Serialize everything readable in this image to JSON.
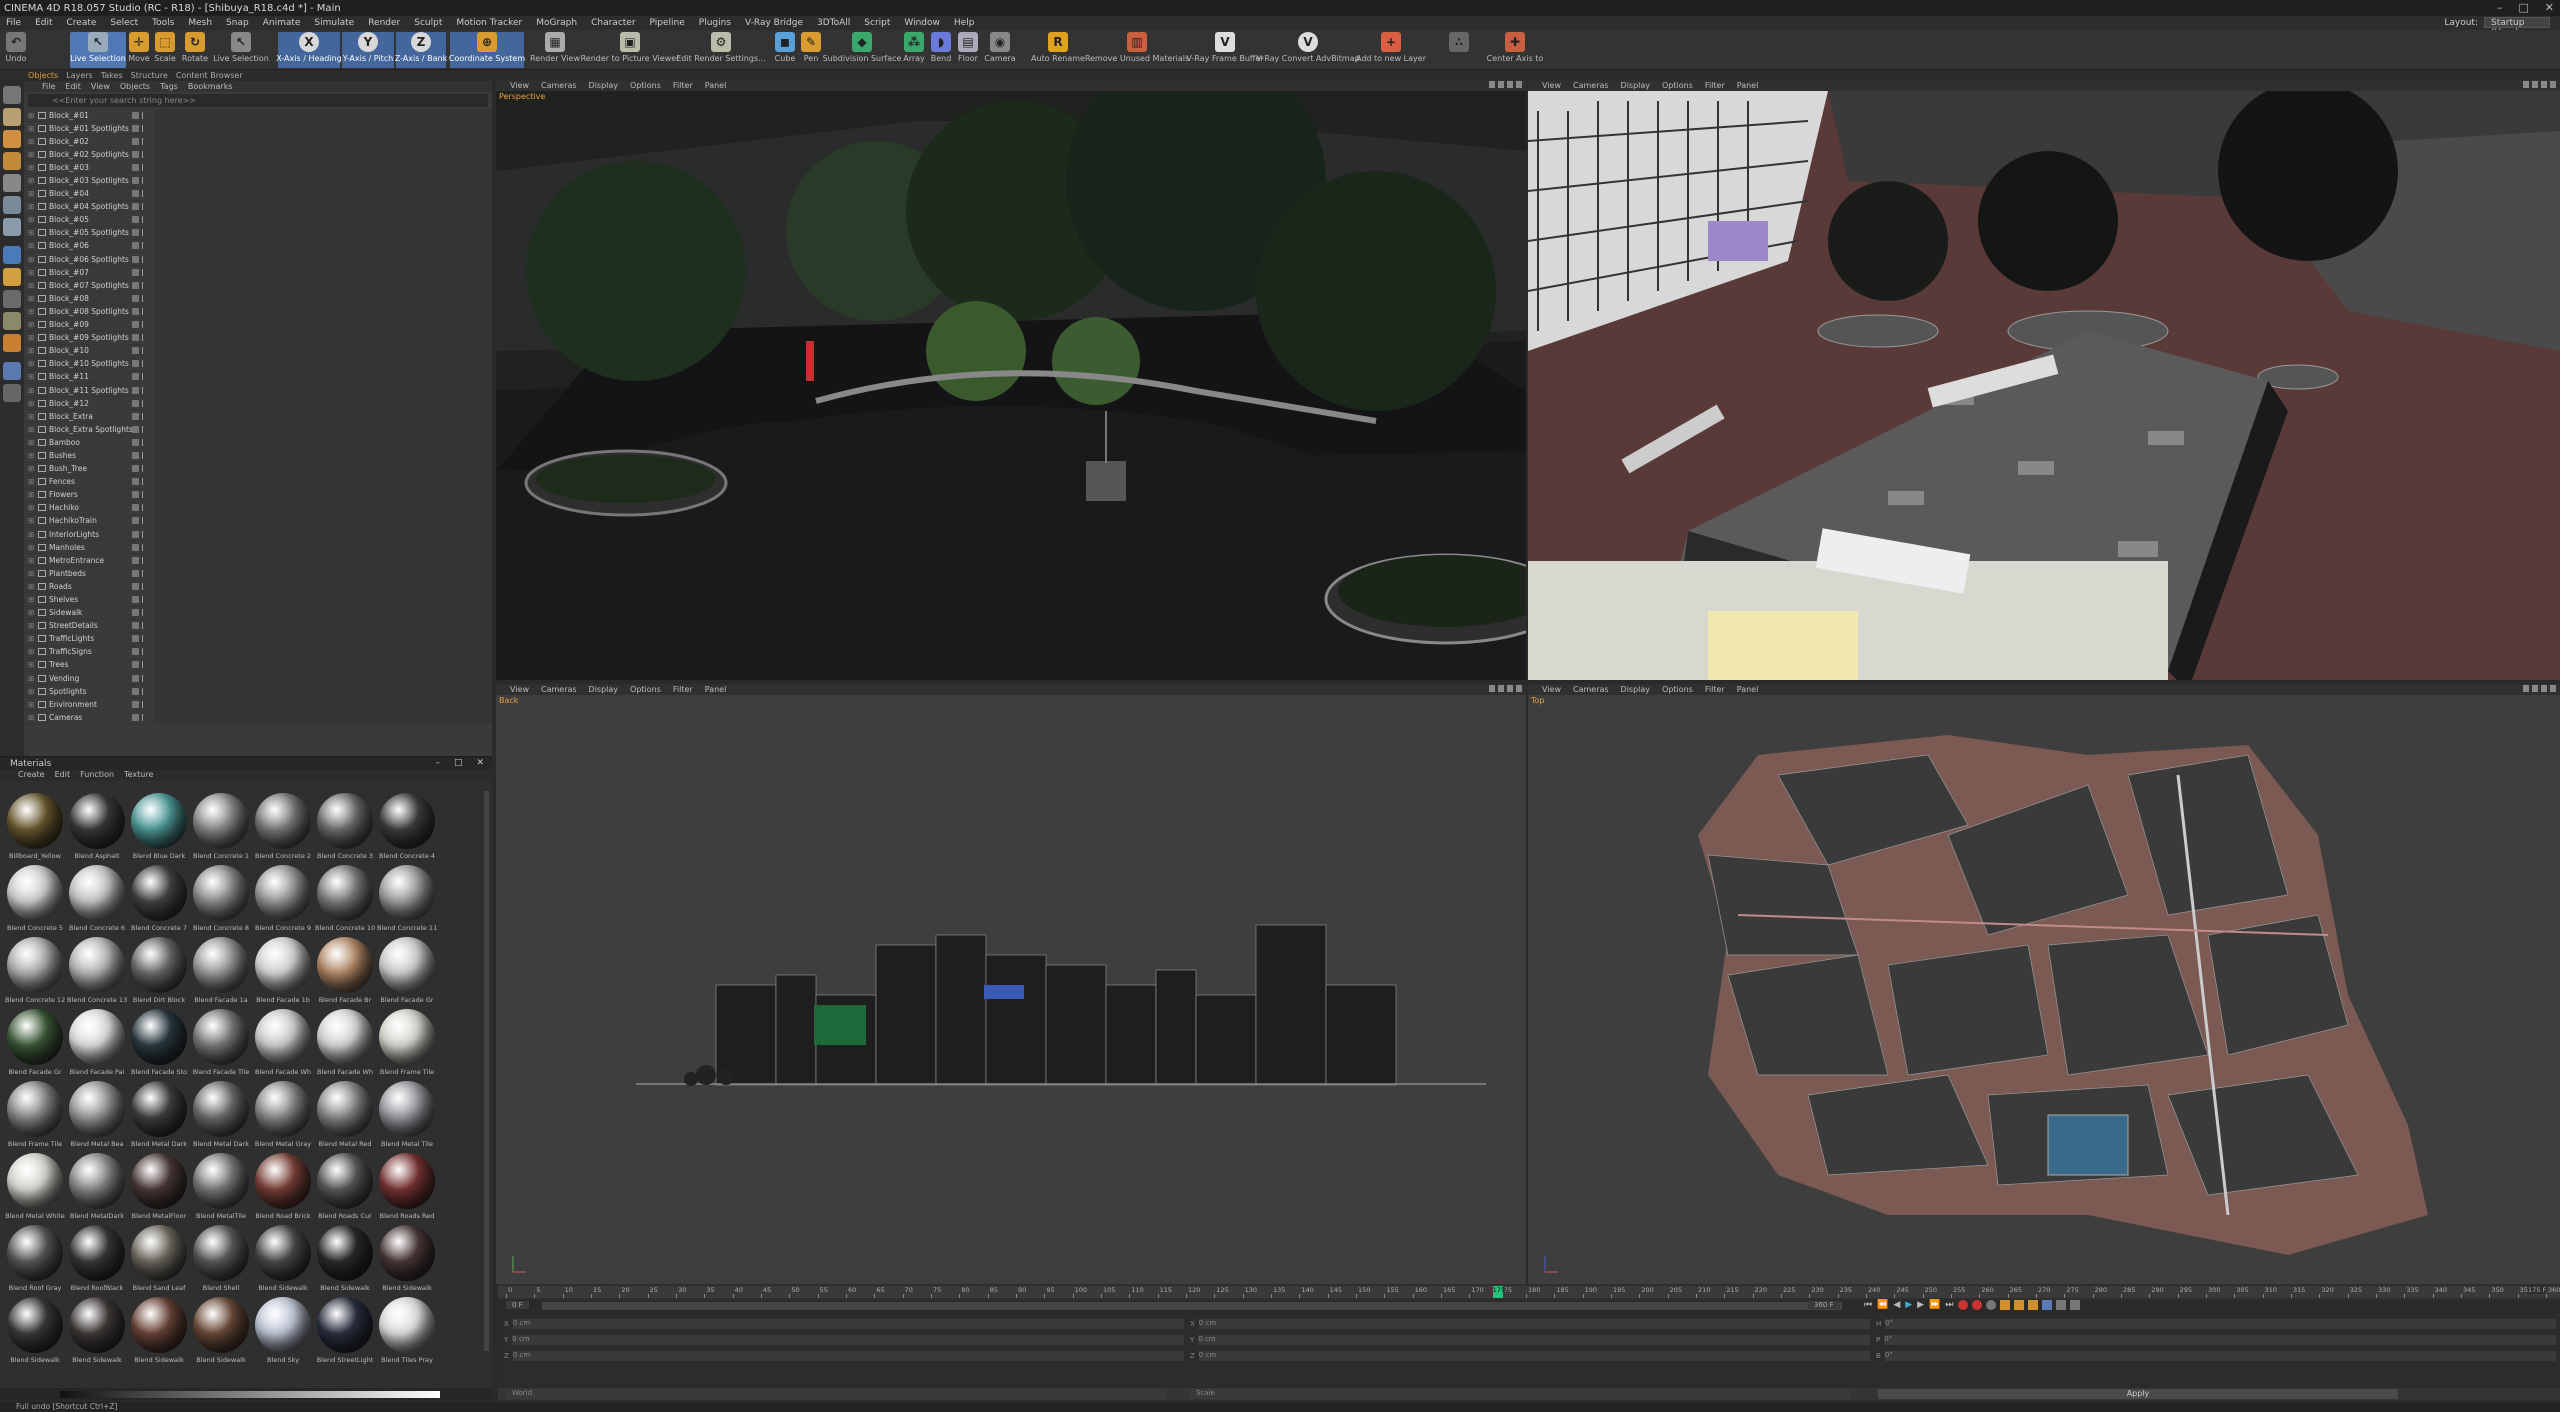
{
  "window": {
    "title": "CINEMA 4D R18.057 Studio (RC - R18) - [Shibuya_R18.c4d *] - Main"
  },
  "menu": {
    "items": [
      "File",
      "Edit",
      "Create",
      "Select",
      "Tools",
      "Mesh",
      "Snap",
      "Animate",
      "Simulate",
      "Render",
      "Sculpt",
      "Motion Tracker",
      "MoGraph",
      "Character",
      "Pipeline",
      "Plugins",
      "V-Ray Bridge",
      "3DToAll",
      "Script",
      "Window",
      "Help"
    ],
    "layout_label": "Layout:",
    "layout_value": "Startup (User)"
  },
  "toolbar": {
    "undo": "Undo",
    "live_selection": "Live Selection",
    "move": "Move",
    "scale": "Scale",
    "rotate": "Rotate",
    "live_selection2": "Live Selection",
    "x_axis": "X-Axis / Heading",
    "y_axis": "Y-Axis / Pitch",
    "z_axis": "Z-Axis / Bank",
    "coord_system": "Coordinate System",
    "render_view": "Render View",
    "render_to_pv": "Render to Picture Viewer",
    "edit_render": "Edit Render Settings...",
    "cube": "Cube",
    "pen": "Pen",
    "subdiv": "Subdivision Surface",
    "array": "Array",
    "bend": "Bend",
    "floor": "Floor",
    "camera": "Camera",
    "auto_rename": "Auto Rename",
    "remove_unused": "Remove Unused Materials",
    "vray_frame_buffer": "V-Ray Frame Buffer",
    "vray_convert": "V-Ray Convert AdvBitmap",
    "add_layer": "Add to new Layer",
    "center_axis": "Center Axis to"
  },
  "object_manager": {
    "tabs": [
      "Objects",
      "Layers",
      "Takes",
      "Structure",
      "Content Browser"
    ],
    "menu": [
      "File",
      "Edit",
      "View",
      "Objects",
      "Tags",
      "Bookmarks"
    ],
    "search_placeholder": "<<Enter your search string here>>",
    "objects": [
      "Block_#01",
      "Block_#01 Spotlights",
      "Block_#02",
      "Block_#02 Spotlights",
      "Block_#03",
      "Block_#03 Spotlights",
      "Block_#04",
      "Block_#04 Spotlights",
      "Block_#05",
      "Block_#05 Spotlights",
      "Block_#06",
      "Block_#06 Spotlights",
      "Block_#07",
      "Block_#07 Spotlights",
      "Block_#08",
      "Block_#08 Spotlights",
      "Block_#09",
      "Block_#09 Spotlights",
      "Block_#10",
      "Block_#10 Spotlights",
      "Block_#11",
      "Block_#11 Spotlights",
      "Block_#12",
      "Block_Extra",
      "Block_Extra Spotlights",
      "Bamboo",
      "Bushes",
      "Bush_Tree",
      "Fences",
      "Flowers",
      "Hachiko",
      "HachikoTrain",
      "InteriorLights",
      "Manholes",
      "MetroEntrance",
      "Plantbeds",
      "Roads",
      "Shelves",
      "Sidewalk",
      "StreetDetails",
      "TrafficLights",
      "TrafficSigns",
      "Trees",
      "Vending",
      "Spotlights",
      "Environment",
      "Cameras"
    ]
  },
  "material_manager": {
    "title": "Materials",
    "menu": [
      "Create",
      "Edit",
      "Function",
      "Texture"
    ],
    "materials": [
      {
        "name": "Billboard_Yellow",
        "color": "#6a5a30"
      },
      {
        "name": "Blend Asphalt",
        "color": "#3a3a3a"
      },
      {
        "name": "Blend Blue Dark",
        "color": "#4d9a98"
      },
      {
        "name": "Blend Concrete 1",
        "color": "#8a8a8a"
      },
      {
        "name": "Blend Concrete 2",
        "color": "#7a7a7a"
      },
      {
        "name": "Blend Concrete 3",
        "color": "#6e6e6e"
      },
      {
        "name": "Blend Concrete 4",
        "color": "#3e3e3e"
      },
      {
        "name": "Blend Concrete 5",
        "color": "#d0d0d0"
      },
      {
        "name": "Blend Concrete 6",
        "color": "#c8c8c8"
      },
      {
        "name": "Blend Concrete 7",
        "color": "#444444"
      },
      {
        "name": "Blend Concrete 8",
        "color": "#8e8e8e"
      },
      {
        "name": "Blend Concrete 9",
        "color": "#9a9a9a"
      },
      {
        "name": "Blend Concrete 10",
        "color": "#7e7e7e"
      },
      {
        "name": "Blend Concrete 11",
        "color": "#a0a0a0"
      },
      {
        "name": "Blend Concrete 12",
        "color": "#b0b0b0"
      },
      {
        "name": "Blend Concrete 13",
        "color": "#b8b8b8"
      },
      {
        "name": "Blend Dirt Block",
        "color": "#6a6a6a"
      },
      {
        "name": "Blend Facade 1a",
        "color": "#9a9a9a"
      },
      {
        "name": "Blend Facade 1b",
        "color": "#d4d4d4"
      },
      {
        "name": "Blend Facade Br",
        "color": "#b48a68"
      },
      {
        "name": "Blend Facade Gr",
        "color": "#cfcfcf"
      },
      {
        "name": "Blend Facade Gr",
        "color": "#3c5a38"
      },
      {
        "name": "Blend Facade Pai",
        "color": "#e0e0e0"
      },
      {
        "name": "Blend Facade Sto",
        "color": "#2a3a40"
      },
      {
        "name": "Blend Facade Tile",
        "color": "#7a7a7a"
      },
      {
        "name": "Blend Facade Wh",
        "color": "#cfcfcf"
      },
      {
        "name": "Blend Facade Wh",
        "color": "#d8d8d8"
      },
      {
        "name": "Blend Frame Tile",
        "color": "#d8d8d0"
      },
      {
        "name": "Blend Frame Tile",
        "color": "#8a8a8a"
      },
      {
        "name": "Blend Metal Bea",
        "color": "#9a9a9a"
      },
      {
        "name": "Blend Metal Dark",
        "color": "#404040"
      },
      {
        "name": "Blend Metal Dark",
        "color": "#6e6e6e"
      },
      {
        "name": "Blend Metal Gray",
        "color": "#8a8a8a"
      },
      {
        "name": "Blend Metal Red",
        "color": "#8a8a8a"
      },
      {
        "name": "Blend Metal Tile",
        "color": "#9a9aa0"
      },
      {
        "name": "Blend Metal White",
        "color": "#d8d8d0"
      },
      {
        "name": "Blend MetalDark",
        "color": "#8a8a8a"
      },
      {
        "name": "Blend MetalFloor",
        "color": "#4a3a38"
      },
      {
        "name": "Blend MetalTile",
        "color": "#7a7a7a"
      },
      {
        "name": "Blend Road Brick",
        "color": "#7a4038"
      },
      {
        "name": "Blend Roads Cur",
        "color": "#5a5a5a"
      },
      {
        "name": "Blend Roads Red",
        "color": "#7a3434"
      },
      {
        "name": "Blend Roof Gray",
        "color": "#5a5a5a"
      },
      {
        "name": "Blend RoofBlack",
        "color": "#383838"
      },
      {
        "name": "Blend Sand Leaf",
        "color": "#6e6a60"
      },
      {
        "name": "Blend Shell",
        "color": "#5a5a5a"
      },
      {
        "name": "Blend Sidewalk",
        "color": "#4a4a4a"
      },
      {
        "name": "Blend Sidewalk",
        "color": "#2a2a2a"
      },
      {
        "name": "Blend Sidewalk",
        "color": "#4a3838"
      },
      {
        "name": "Blend Sidewalk",
        "color": "#3a3a3a"
      },
      {
        "name": "Blend Sidewalk",
        "color": "#3e3a38"
      },
      {
        "name": "Blend Sidewalk",
        "color": "#6a4438"
      },
      {
        "name": "Blend Sidewalk",
        "color": "#6a4a38"
      },
      {
        "name": "Blend Sky",
        "color": "#c0c8d8"
      },
      {
        "name": "Blend StreetLight",
        "color": "#2a3040"
      },
      {
        "name": "Blend Tiles Pray",
        "color": "#e0e0e0"
      }
    ]
  },
  "viewports": {
    "menu": [
      "View",
      "Cameras",
      "Display",
      "Options",
      "Filter",
      "Panel"
    ],
    "labels": {
      "perspective": "Perspective",
      "back": "Back",
      "top": "Top"
    }
  },
  "timeline": {
    "ticks": [
      "0",
      "5",
      "10",
      "15",
      "20",
      "25",
      "30",
      "35",
      "40",
      "45",
      "50",
      "55",
      "60",
      "65",
      "70",
      "75",
      "80",
      "85",
      "90",
      "95",
      "100",
      "105",
      "110",
      "115",
      "120",
      "125",
      "130",
      "135",
      "140",
      "145",
      "150",
      "155",
      "160",
      "165",
      "170",
      "175",
      "180",
      "185",
      "190",
      "195",
      "200",
      "205",
      "210",
      "215",
      "220",
      "225",
      "230",
      "235",
      "240",
      "245",
      "250",
      "255",
      "260",
      "265",
      "270",
      "275",
      "280",
      "285",
      "290",
      "295",
      "300",
      "305",
      "310",
      "315",
      "320",
      "325",
      "330",
      "335",
      "340",
      "345",
      "350",
      "355",
      "360"
    ],
    "current_frame": "175",
    "frame_start": "0 F",
    "frame_end": "360 F",
    "end_readout": "175 F"
  },
  "coordinates": {
    "rows": [
      [
        "X",
        "0 cm",
        "X",
        "0 cm",
        "H",
        "0°"
      ],
      [
        "Y",
        "0 cm",
        "Y",
        "0 cm",
        "P",
        "0°"
      ],
      [
        "Z",
        "0 cm",
        "Z",
        "0 cm",
        "B",
        "0°"
      ]
    ],
    "world": "World",
    "scale": "Scale",
    "apply": "Apply"
  },
  "status": {
    "text": "Full undo [Shortcut Ctrl+Z]"
  },
  "colors": {
    "accent": "#4f78b4",
    "tab_active": "#e29c3c",
    "playhead": "#27c27e"
  }
}
